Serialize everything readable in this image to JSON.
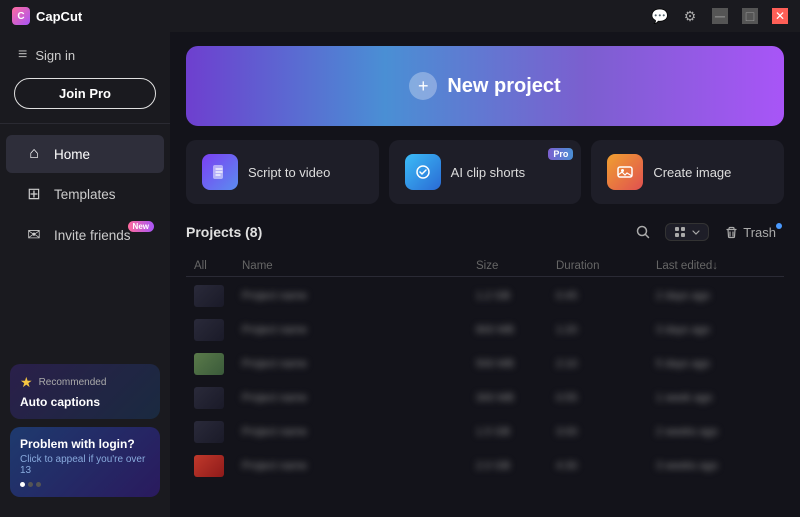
{
  "app": {
    "name": "CapCut",
    "logo_icon": "C"
  },
  "titlebar": {
    "controls": [
      "chat-icon",
      "settings-icon",
      "minimize-icon",
      "maximize-icon",
      "close-icon"
    ]
  },
  "sidebar": {
    "sign_in": "Sign in",
    "join_pro": "Join Pro",
    "nav_items": [
      {
        "id": "home",
        "label": "Home",
        "icon": "⌂",
        "active": true
      },
      {
        "id": "templates",
        "label": "Templates",
        "icon": "⊞",
        "active": false
      },
      {
        "id": "invite",
        "label": "Invite friends",
        "icon": "✉",
        "badge": "New"
      }
    ],
    "recommended": {
      "label": "Recommended",
      "title": "Auto captions"
    },
    "login_problem": {
      "title": "Problem with login?",
      "subtitle": "Click to appeal if you're over 13"
    }
  },
  "banner": {
    "plus_icon": "+",
    "label": "New project"
  },
  "feature_cards": [
    {
      "id": "script-to-video",
      "label": "Script to video",
      "icon": "▶",
      "pro": false
    },
    {
      "id": "ai-clip-shorts",
      "label": "AI clip shorts",
      "icon": "✂",
      "pro": true
    },
    {
      "id": "create-image",
      "label": "Create image",
      "icon": "🖼",
      "pro": false
    }
  ],
  "projects": {
    "title": "Projects",
    "count": 8,
    "title_full": "Projects  (8)",
    "columns": [
      "All",
      "Name",
      "Size",
      "Duration",
      "Last edited↓"
    ],
    "trash_label": "Trash",
    "rows": [
      {
        "thumb_type": "dark",
        "name": "...",
        "size": "...",
        "duration": "...",
        "date": "..."
      },
      {
        "thumb_type": "dark",
        "name": "...",
        "size": "...",
        "duration": "...",
        "date": "..."
      },
      {
        "thumb_type": "img",
        "name": "...",
        "size": "...",
        "duration": "...",
        "date": "..."
      },
      {
        "thumb_type": "dark",
        "name": "...",
        "size": "...",
        "duration": "...",
        "date": "..."
      },
      {
        "thumb_type": "dark",
        "name": "...",
        "size": "...",
        "duration": "...",
        "date": "..."
      },
      {
        "thumb_type": "red",
        "name": "...",
        "size": "...",
        "duration": "...",
        "date": "..."
      }
    ]
  }
}
